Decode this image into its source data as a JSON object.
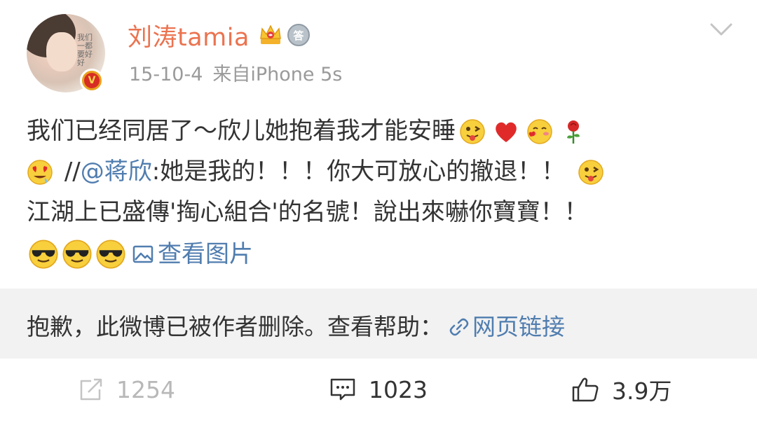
{
  "author": {
    "avatar_text": "我们一都要好好",
    "verified_badge": "V",
    "username": "刘涛tamia",
    "badges": [
      "crown-icon",
      "medal-icon"
    ],
    "medal_text": "答"
  },
  "meta": {
    "date": "15-10-4",
    "source": "来自iPhone 5s"
  },
  "content": {
    "line1": "我们已经同居了～欣儿她抱着我才能安睡",
    "line2_prefix": "//",
    "mention": "@蒋欣",
    "line2_text": ":她是我的！！！你大可放心的撤退！！",
    "line3": "江湖上已盛傳'掏心組合'的名號！說出來嚇你寶寶！！",
    "view_pictures": "查看图片",
    "emojis_line1": [
      "tongue-face",
      "heart",
      "blush-face",
      "rose"
    ],
    "emojis_line2": [
      "heart-eyes-face"
    ],
    "emojis_line2_end": [
      "tongue-face"
    ],
    "emojis_line4": [
      "sunglasses-face",
      "sunglasses-face",
      "sunglasses-face"
    ]
  },
  "repost": {
    "deleted_notice": "抱歉，此微博已被作者删除。查看帮助：",
    "help_link": "网页链接"
  },
  "actions": {
    "repost_count": "1254",
    "comment_count": "1023",
    "like_count": "3.9万"
  },
  "colors": {
    "username": "#eb7350",
    "link": "#507daf",
    "meta": "#9a9a9a",
    "repost_bg": "#f2f2f2"
  }
}
